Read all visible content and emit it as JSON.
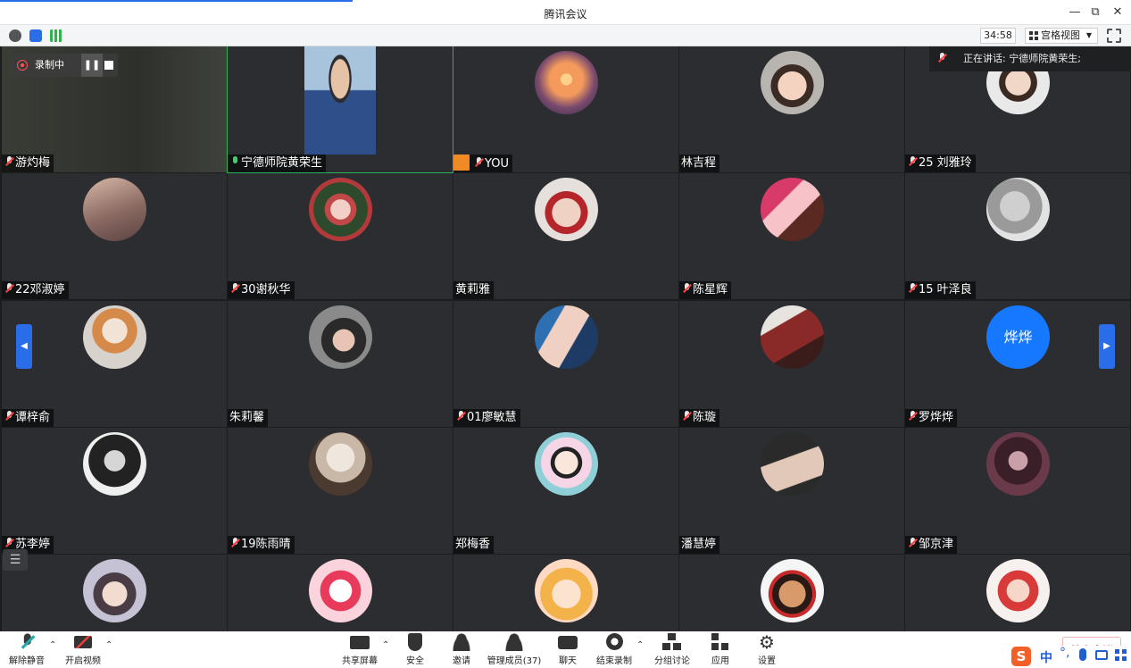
{
  "window": {
    "title": "腾讯会议"
  },
  "infobar": {
    "timer": "34:58",
    "view_label": "宫格视图"
  },
  "recording": {
    "label": "录制中"
  },
  "speaking": {
    "text": "正在讲话: 宁德师院黄荣生;"
  },
  "participants": [
    {
      "name": "游灼梅",
      "mic": "muted",
      "avatar": "video-dark"
    },
    {
      "name": "宁德师院黄荣生",
      "mic": "on",
      "avatar": "video-person"
    },
    {
      "name": "YOU",
      "mic": "muted",
      "avatar": "sunset",
      "host": true
    },
    {
      "name": "林吉程",
      "mic": "none",
      "avatar": "child"
    },
    {
      "name": "25 刘雅玲",
      "mic": "muted",
      "avatar": "boy-portrait"
    },
    {
      "name": "22邓淑婷",
      "mic": "muted",
      "avatar": "figure-pink"
    },
    {
      "name": "30谢秋华",
      "mic": "muted",
      "avatar": "flowers"
    },
    {
      "name": "黄莉雅",
      "mic": "none",
      "avatar": "red-hair-girl"
    },
    {
      "name": "陈星辉",
      "mic": "muted",
      "avatar": "cake"
    },
    {
      "name": "15 叶泽良",
      "mic": "muted",
      "avatar": "cat-grey"
    },
    {
      "name": "谭梓俞",
      "mic": "muted",
      "avatar": "cat-orange"
    },
    {
      "name": "朱莉馨",
      "mic": "none",
      "avatar": "woman-dark"
    },
    {
      "name": "01廖敏慧",
      "mic": "muted",
      "avatar": "anime-blue-hair"
    },
    {
      "name": "陈璇",
      "mic": "muted",
      "avatar": "red-figure"
    },
    {
      "name": "罗烨烨",
      "mic": "muted",
      "avatar": "text",
      "avatar_text": "烨烨"
    },
    {
      "name": "苏李婷",
      "mic": "muted",
      "avatar": "woman-bw"
    },
    {
      "name": "19陈雨晴",
      "mic": "muted",
      "avatar": "teddy-bear"
    },
    {
      "name": "郑梅香",
      "mic": "none",
      "avatar": "cartoon-girl"
    },
    {
      "name": "潘慧婷",
      "mic": "none",
      "avatar": "hand-tattoo"
    },
    {
      "name": "邹京津",
      "mic": "muted",
      "avatar": "dark-portrait"
    },
    {
      "name": "",
      "mic": "none",
      "avatar": "anime-girl-hat"
    },
    {
      "name": "",
      "mic": "none",
      "avatar": "strawberry-cartoon"
    },
    {
      "name": "",
      "mic": "none",
      "avatar": "blonde-cartoon"
    },
    {
      "name": "",
      "mic": "none",
      "avatar": "doll-red"
    },
    {
      "name": "",
      "mic": "none",
      "avatar": "baby-red"
    }
  ],
  "toolbar": {
    "unmute": "解除静音",
    "video": "开启视频",
    "share": "共享屏幕",
    "security": "安全",
    "invite": "邀请",
    "members": "管理成员(37)",
    "chat": "聊天",
    "end_record": "结束录制",
    "breakout": "分组讨论",
    "apps": "应用",
    "settings": "设置",
    "end_meeting": "结束会议"
  },
  "ime": {
    "lang": "中"
  },
  "colors": {
    "accent": "#2a6de8",
    "tile": "#2c2d30",
    "muted": "#ff4040",
    "mic_on": "#3ed16b",
    "end": "#e84040"
  }
}
